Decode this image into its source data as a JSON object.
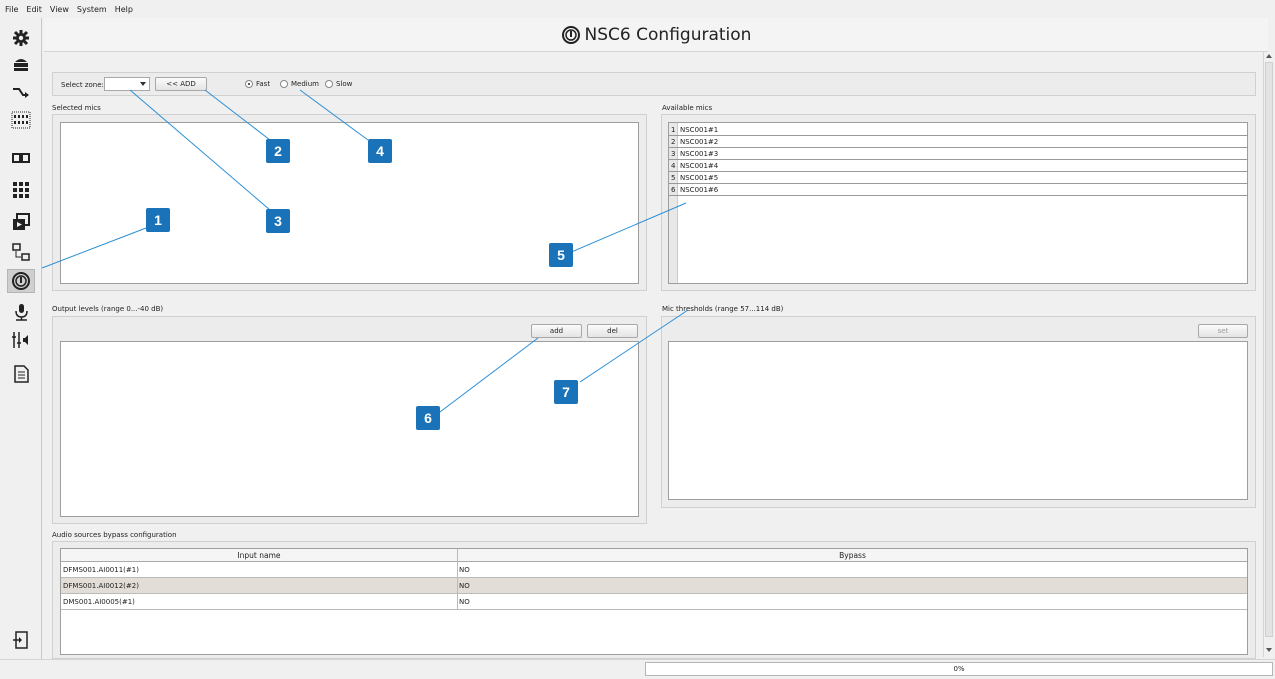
{
  "menu": [
    "File",
    "Edit",
    "View",
    "System",
    "Help"
  ],
  "sidebar": [
    {
      "icon": "gear-icon"
    },
    {
      "icon": "server-icon"
    },
    {
      "icon": "route-icon"
    },
    {
      "icon": "speaker-grid-icon"
    },
    {
      "icon": "dual-panel-icon"
    },
    {
      "icon": "matrix-icon"
    },
    {
      "icon": "media-icon"
    },
    {
      "icon": "transfer-icon"
    },
    {
      "icon": "nsc6-icon",
      "active": true
    },
    {
      "icon": "microphone-icon"
    },
    {
      "icon": "mixer-icon"
    },
    {
      "icon": "document-icon"
    }
  ],
  "title": "NSC6 Configuration",
  "toolbar": {
    "zone_label": "Select zone:",
    "zone_value": "",
    "add_label": "<< ADD",
    "speed": {
      "fast": "Fast",
      "medium": "Medium",
      "slow": "Slow",
      "selected": "fast"
    }
  },
  "selected_mics": {
    "label": "Selected mics"
  },
  "available_mics": {
    "label": "Available mics",
    "items": [
      {
        "n": "1",
        "name": "NSC001#1"
      },
      {
        "n": "2",
        "name": "NSC001#2"
      },
      {
        "n": "3",
        "name": "NSC001#3"
      },
      {
        "n": "4",
        "name": "NSC001#4"
      },
      {
        "n": "5",
        "name": "NSC001#5"
      },
      {
        "n": "6",
        "name": "NSC001#6"
      }
    ]
  },
  "output_levels": {
    "label": "Output levels (range 0...-40 dB)",
    "add": "add",
    "del": "del"
  },
  "thresholds": {
    "label": "Mic thresholds (range 57...114 dB)",
    "set": "set"
  },
  "bypass": {
    "label": "Audio sources bypass configuration",
    "headers": [
      "Input name",
      "Bypass"
    ],
    "rows": [
      {
        "name": "DFMS001.AI0011(#1)",
        "bypass": "NO"
      },
      {
        "name": "DFMS001.AI0012(#2)",
        "bypass": "NO"
      },
      {
        "name": "DMS001.AI0005(#1)",
        "bypass": "NO"
      }
    ]
  },
  "progress": "0%",
  "callouts": [
    "1",
    "2",
    "3",
    "4",
    "5",
    "6",
    "7"
  ],
  "colors": {
    "callout": "#1a73b8",
    "callout_line": "#2b8fd6",
    "alt_row": "#e2ddd6"
  }
}
